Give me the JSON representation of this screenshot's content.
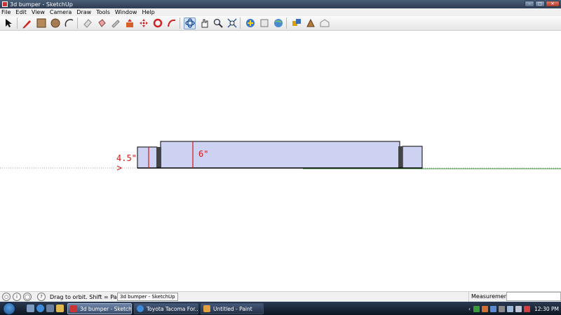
{
  "window": {
    "title": "3d bumper - SketchUp"
  },
  "menu": [
    "File",
    "Edit",
    "View",
    "Camera",
    "Draw",
    "Tools",
    "Window",
    "Help"
  ],
  "toolbar": {
    "tools": [
      "select-icon",
      "pencil-icon",
      "line-icon",
      "rectangle-icon",
      "circle-icon",
      "arc-icon",
      "eraser-icon",
      "paint-bucket-icon",
      "tape-measure-icon",
      "push-pull-icon",
      "move-icon",
      "rotate-icon",
      "follow-me-icon",
      "orbit-icon",
      "pan-icon",
      "zoom-icon",
      "zoom-extents-icon",
      "get-models-icon",
      "share-model-icon",
      "google-earth-icon",
      "component-icon",
      "styles-icon",
      "warehouse-icon"
    ]
  },
  "canvas": {
    "dimension_left": "4.5\"",
    "dimension_center": "6\""
  },
  "status": {
    "hint": "Drag to orbit.  Shift = Pan",
    "tooltip": "3d bumper - SketchUp",
    "measurements_label": "Measurements"
  },
  "taskbar": {
    "tasks": [
      {
        "label": "3d bumper - Sketch...",
        "active": true
      },
      {
        "label": "Toyota Tacoma For...",
        "active": false
      },
      {
        "label": "Untitled - Paint",
        "active": false
      }
    ],
    "clock": "12:30 PM"
  },
  "colors": {
    "model_fill": "#cdd2f3",
    "dimension_red": "#d01818",
    "axis_green": "#3a9a3a"
  }
}
